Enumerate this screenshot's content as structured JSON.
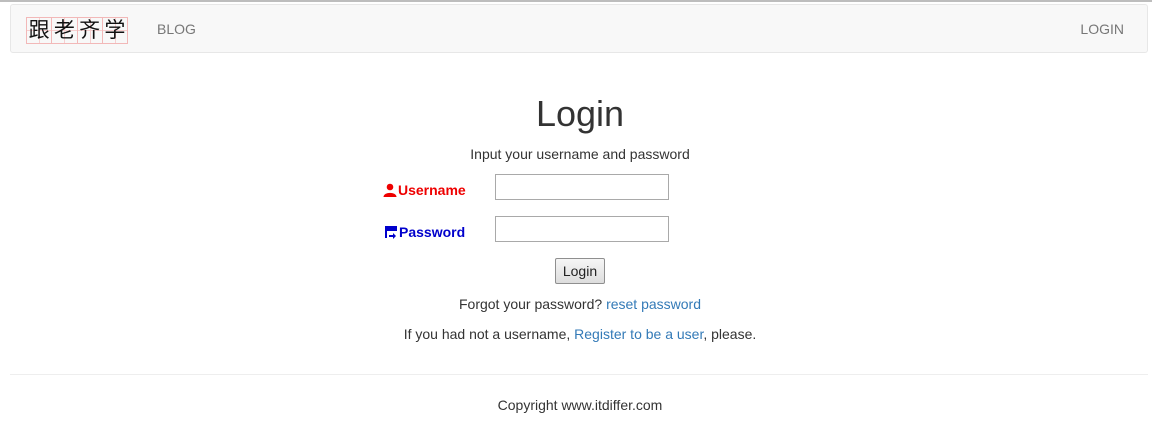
{
  "navbar": {
    "brand_chars": [
      "跟",
      "老",
      "齐",
      "学"
    ],
    "blog_label": "BLOG",
    "login_label": "LOGIN"
  },
  "main": {
    "title": "Login",
    "subtitle": "Input your username and password",
    "username_label": "Username",
    "password_label": "Password",
    "username_value": "",
    "password_value": "",
    "login_button": "Login",
    "forgot_prefix": "Forgot your password? ",
    "reset_link": "reset password",
    "register_prefix": "If you had not a username, ",
    "register_link": "Register to be a user",
    "register_suffix": ", please."
  },
  "footer": {
    "copyright": "Copyright www.itdiffer.com"
  },
  "colors": {
    "username_label": "#ee0000",
    "password_label": "#0000cc",
    "link": "#337ab7",
    "nav_text": "#777777",
    "navbar_bg": "#f8f8f8"
  },
  "icons": {
    "username": "user-icon",
    "password": "log-in-icon"
  }
}
